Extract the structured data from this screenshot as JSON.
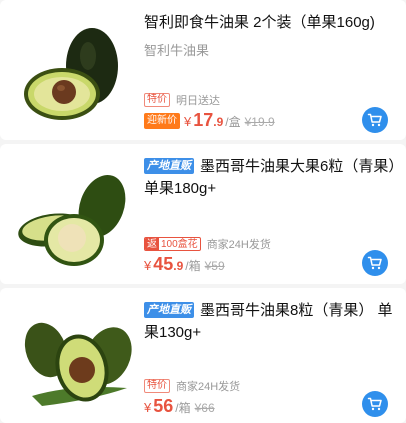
{
  "products": [
    {
      "title": "智利即食牛油果 2个装（单果160g)",
      "subtitle": "智利牛油果",
      "badge": "特价",
      "meta": "明日送达",
      "promo": "迎新价",
      "price_yen": "¥",
      "price_int": "17",
      "price_dec": ".9",
      "unit": "/盒",
      "old_price": "¥19.9",
      "cart_icon": "cart-icon"
    },
    {
      "origin_tag": "产地直贩",
      "title": "墨西哥牛油果大果6粒（青果）单果180g+",
      "coupon_left": "返",
      "coupon_right": "100盒花",
      "meta": "商家24H发货",
      "price_yen": "¥",
      "price_int": "45",
      "price_dec": ".9",
      "unit": "/箱",
      "old_price": "¥59",
      "cart_icon": "cart-icon"
    },
    {
      "origin_tag": "产地直贩",
      "title": "墨西哥牛油果8粒（青果） 单果130g+",
      "badge": "特价",
      "meta": "商家24H发货",
      "price_yen": "¥",
      "price_int": "56",
      "price_dec": "",
      "unit": "/箱",
      "old_price": "¥66",
      "cart_icon": "cart-icon"
    }
  ],
  "colors": {
    "accent": "#e8533f",
    "cart": "#2f8fec",
    "origin_tag": "#3d8fe8",
    "promo": "#ff7a1a"
  }
}
